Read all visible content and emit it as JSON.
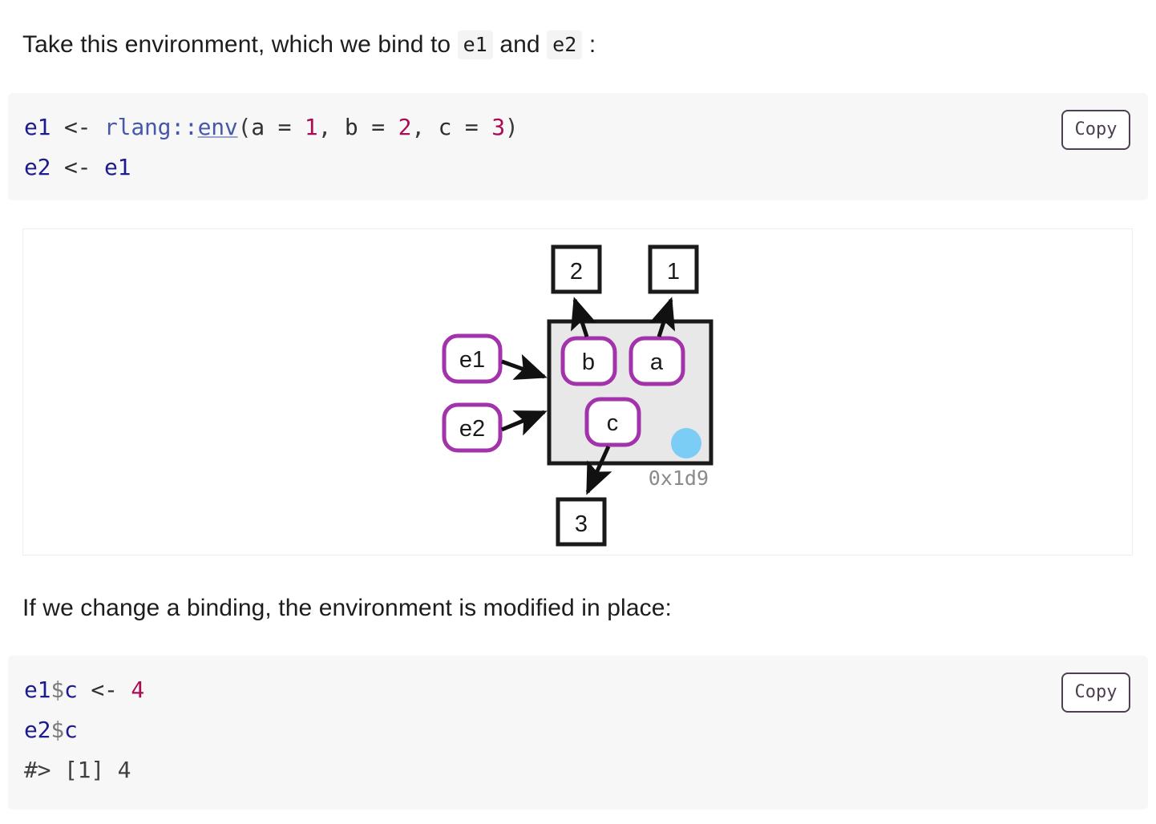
{
  "paragraphs": {
    "intro_before": "Take this environment, which we bind to ",
    "intro_code_1": "e1",
    "intro_middle": " and ",
    "intro_code_2": "e2",
    "intro_after": " :",
    "second": "If we change a binding, the environment is modified in place:"
  },
  "code_blocks": [
    {
      "id": "codeblock-1",
      "copy_label": "Copy",
      "lines": [
        "e1 <- rlang::env(a = 1, b = 2, c = 3)",
        "e2 <- e1"
      ],
      "tokens_line1": {
        "var": "e1",
        "assign": "<-",
        "namespace": "rlang::",
        "function": "env",
        "args": "(a = 1, b = 2, c = 3)",
        "numbers": [
          "1",
          "2",
          "3"
        ],
        "arg_names": [
          "a",
          "b",
          "c"
        ]
      },
      "tokens_line2": {
        "var": "e2",
        "assign": "<-",
        "value": "e1"
      }
    },
    {
      "id": "codeblock-2",
      "copy_label": "Copy",
      "lines": [
        "e1$c <- 4",
        "e2$c",
        "#> [1] 4"
      ],
      "tokens_line1": {
        "var": "e1",
        "dollar": "$",
        "field": "c",
        "assign": "<-",
        "number": "4"
      },
      "tokens_line2": {
        "var": "e2",
        "dollar": "$",
        "field": "c"
      },
      "tokens_line3": {
        "prompt": "#>",
        "index": "[1]",
        "value": "4"
      }
    }
  ],
  "diagram": {
    "env_label": "0x1d9",
    "pointer_boxes": [
      {
        "name": "e1",
        "label": "e1"
      },
      {
        "name": "e2",
        "label": "e2"
      }
    ],
    "bindings": [
      {
        "name": "b",
        "label": "b",
        "value": "2"
      },
      {
        "name": "a",
        "label": "a",
        "value": "1"
      },
      {
        "name": "c",
        "label": "c",
        "value": "3"
      }
    ],
    "value_boxes": [
      {
        "name": "value-2",
        "label": "2"
      },
      {
        "name": "value-1",
        "label": "1"
      },
      {
        "name": "value-3",
        "label": "3"
      }
    ],
    "colors": {
      "binding_border": "#a333aa",
      "env_fill": "#e8e8e8",
      "env_border": "#1a1a1a",
      "circle": "#7bcdf5",
      "arrow": "#111111",
      "hex_label": "#8a8a8a"
    }
  }
}
